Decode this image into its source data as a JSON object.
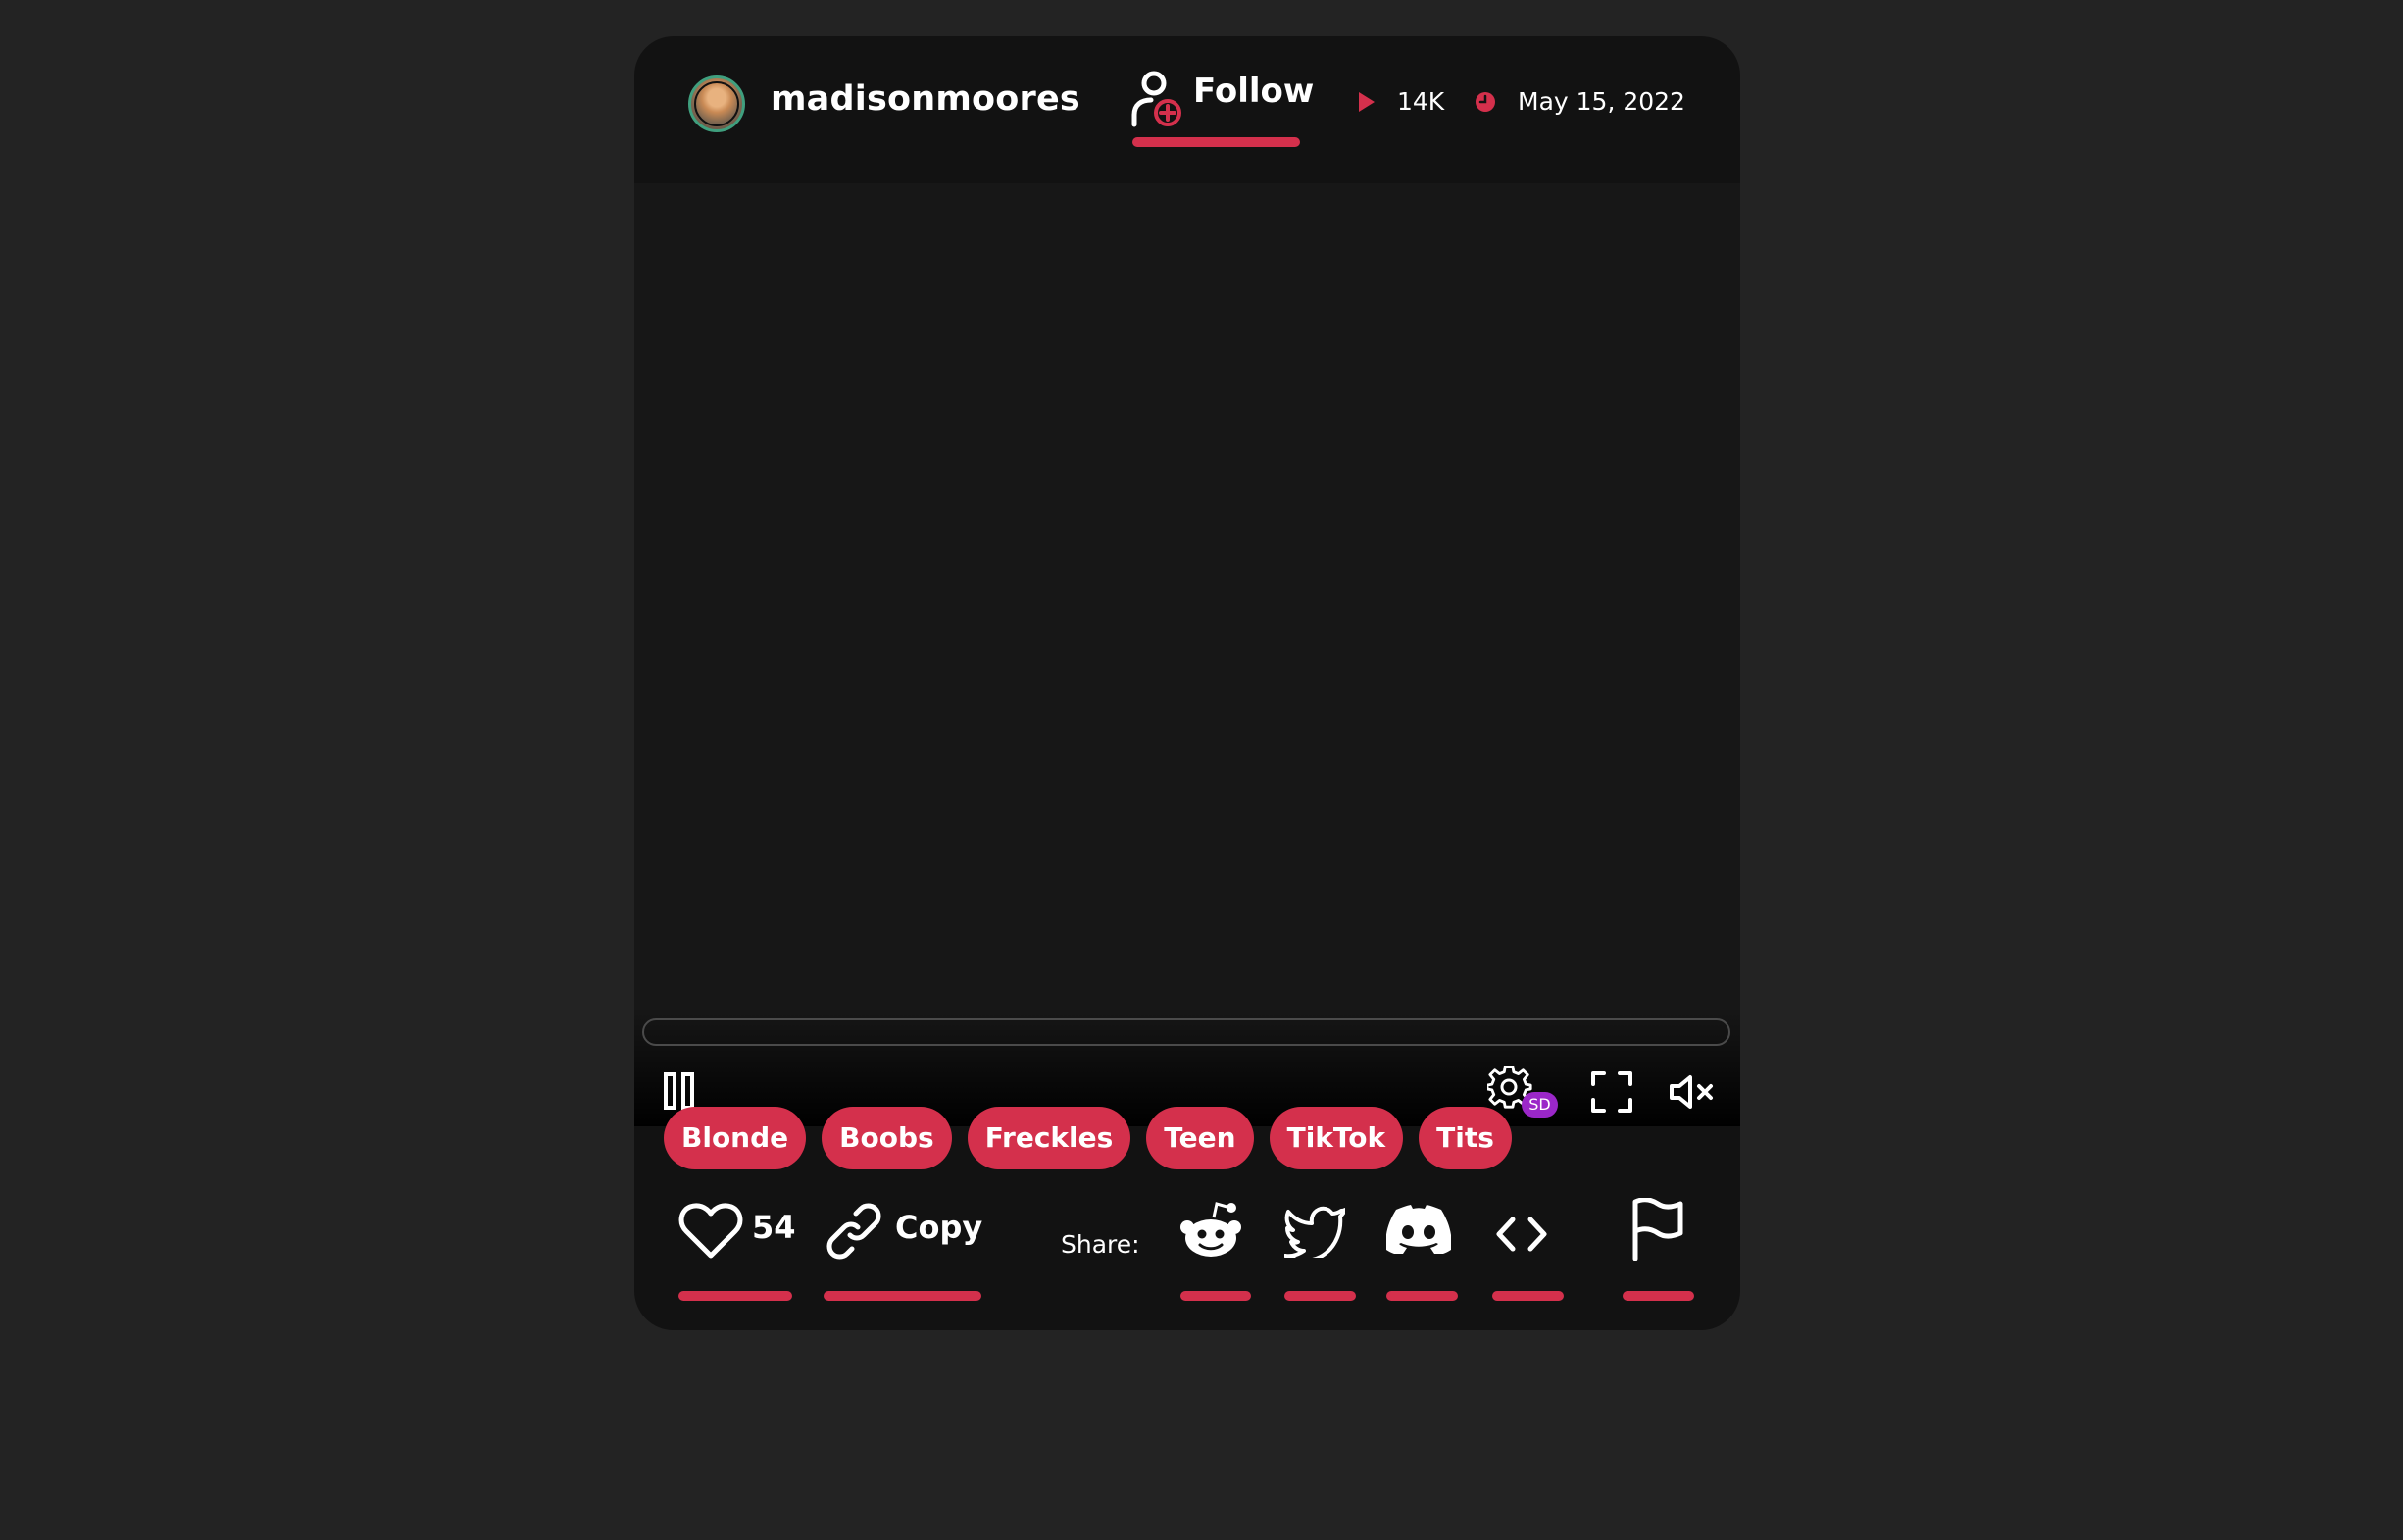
{
  "header": {
    "username": "madisonmoores",
    "follow_label": "Follow",
    "views": "14K",
    "date": "May 15, 2022"
  },
  "player": {
    "quality_badge": "SD",
    "progress_fraction": 0,
    "state": "paused-icon-shown",
    "muted": true
  },
  "tags": [
    "Blonde",
    "Boobs",
    "Freckles",
    "Teen",
    "TikTok",
    "Tits"
  ],
  "actions": {
    "likes": "54",
    "copy_label": "Copy",
    "share_label": "Share:"
  },
  "colors": {
    "accent": "#d4304c",
    "page_bg": "#232323",
    "card_bg": "#121212",
    "video_bg": "#171717",
    "avatar_ring": "#3f9f7e",
    "sd_badge": "#9b27c8"
  },
  "icons": [
    "user-plus-icon",
    "play-icon",
    "clock-icon",
    "pause-icon",
    "gear-icon",
    "fullscreen-icon",
    "mute-icon",
    "heart-icon",
    "link-icon",
    "reddit-icon",
    "twitter-icon",
    "discord-icon",
    "embed-code-icon",
    "flag-icon"
  ]
}
